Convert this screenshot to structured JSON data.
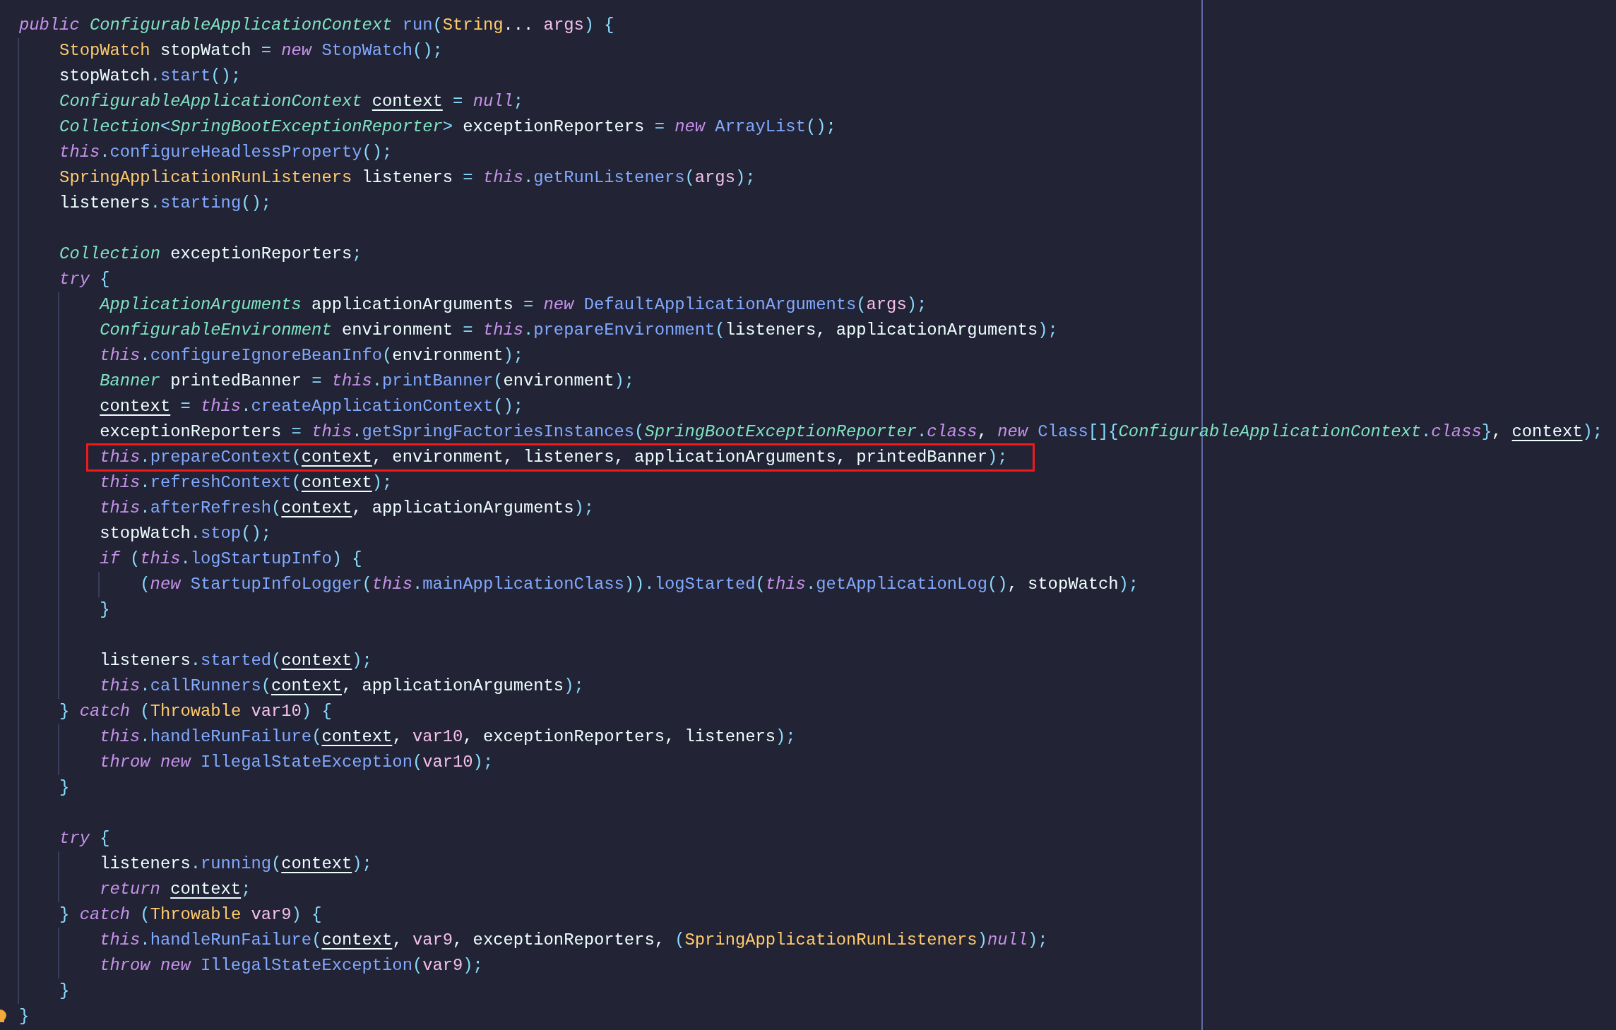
{
  "editor": {
    "lines": [
      {
        "highlighted": false,
        "tokens": [
          {
            "text": "public ",
            "kind": "keyword"
          },
          {
            "text": "ConfigurableApplicationContext ",
            "kind": "interface"
          },
          {
            "text": "run",
            "kind": "function"
          },
          {
            "text": "(",
            "kind": "punct"
          },
          {
            "text": "String",
            "kind": "type"
          },
          {
            "text": "... ",
            "kind": "plain"
          },
          {
            "text": "args",
            "kind": "param"
          },
          {
            "text": ") {",
            "kind": "punct"
          }
        ],
        "children": [
          {
            "highlighted": false,
            "tokens": [
              {
                "text": "StopWatch",
                "kind": "type"
              },
              {
                "text": " stopWatch ",
                "kind": "plain"
              },
              {
                "text": "= ",
                "kind": "punct"
              },
              {
                "text": "new ",
                "kind": "keyword"
              },
              {
                "text": "StopWatch",
                "kind": "function"
              },
              {
                "text": "();",
                "kind": "punct"
              }
            ]
          },
          {
            "highlighted": false,
            "tokens": [
              {
                "text": "stopWatch",
                "kind": "plain"
              },
              {
                "text": ".",
                "kind": "punct"
              },
              {
                "text": "start",
                "kind": "function"
              },
              {
                "text": "();",
                "kind": "punct"
              }
            ]
          },
          {
            "highlighted": false,
            "tokens": [
              {
                "text": "ConfigurableApplicationContext ",
                "kind": "interface"
              },
              {
                "text": "context",
                "kind": "field"
              },
              {
                "text": " = ",
                "kind": "punct"
              },
              {
                "text": "null",
                "kind": "keyword"
              },
              {
                "text": ";",
                "kind": "punct"
              }
            ]
          },
          {
            "highlighted": false,
            "tokens": [
              {
                "text": "Collection",
                "kind": "interface"
              },
              {
                "text": "<",
                "kind": "punct"
              },
              {
                "text": "SpringBootExceptionReporter",
                "kind": "interface"
              },
              {
                "text": ">",
                "kind": "punct"
              },
              {
                "text": " exceptionReporters ",
                "kind": "plain"
              },
              {
                "text": "= ",
                "kind": "punct"
              },
              {
                "text": "new ",
                "kind": "keyword"
              },
              {
                "text": "ArrayList",
                "kind": "function"
              },
              {
                "text": "();",
                "kind": "punct"
              }
            ]
          },
          {
            "highlighted": false,
            "tokens": [
              {
                "text": "this",
                "kind": "keyword"
              },
              {
                "text": ".",
                "kind": "punct"
              },
              {
                "text": "configureHeadlessProperty",
                "kind": "function"
              },
              {
                "text": "();",
                "kind": "punct"
              }
            ]
          },
          {
            "highlighted": false,
            "tokens": [
              {
                "text": "SpringApplicationRunListeners",
                "kind": "type"
              },
              {
                "text": " listeners ",
                "kind": "plain"
              },
              {
                "text": "= ",
                "kind": "punct"
              },
              {
                "text": "this",
                "kind": "keyword"
              },
              {
                "text": ".",
                "kind": "punct"
              },
              {
                "text": "getRunListeners",
                "kind": "function"
              },
              {
                "text": "(",
                "kind": "punct"
              },
              {
                "text": "args",
                "kind": "param"
              },
              {
                "text": ");",
                "kind": "punct"
              }
            ]
          },
          {
            "highlighted": false,
            "tokens": [
              {
                "text": "listeners",
                "kind": "plain"
              },
              {
                "text": ".",
                "kind": "punct"
              },
              {
                "text": "starting",
                "kind": "function"
              },
              {
                "text": "();",
                "kind": "punct"
              }
            ]
          },
          {
            "highlighted": false
          },
          {
            "highlighted": false,
            "tokens": [
              {
                "text": "Collection",
                "kind": "interface"
              },
              {
                "text": " exceptionReporters",
                "kind": "plain"
              },
              {
                "text": ";",
                "kind": "punct"
              }
            ]
          },
          {
            "highlighted": false,
            "tokens": [
              {
                "text": "try ",
                "kind": "keyword"
              },
              {
                "text": "{",
                "kind": "punct"
              }
            ],
            "children": [
              {
                "highlighted": false,
                "tokens": [
                  {
                    "text": "ApplicationArguments",
                    "kind": "interface"
                  },
                  {
                    "text": " applicationArguments ",
                    "kind": "plain"
                  },
                  {
                    "text": "= ",
                    "kind": "punct"
                  },
                  {
                    "text": "new ",
                    "kind": "keyword"
                  },
                  {
                    "text": "DefaultApplicationArguments",
                    "kind": "function"
                  },
                  {
                    "text": "(",
                    "kind": "punct"
                  },
                  {
                    "text": "args",
                    "kind": "param"
                  },
                  {
                    "text": ");",
                    "kind": "punct"
                  }
                ]
              },
              {
                "highlighted": false,
                "tokens": [
                  {
                    "text": "ConfigurableEnvironment",
                    "kind": "interface"
                  },
                  {
                    "text": " environment ",
                    "kind": "plain"
                  },
                  {
                    "text": "= ",
                    "kind": "punct"
                  },
                  {
                    "text": "this",
                    "kind": "keyword"
                  },
                  {
                    "text": ".",
                    "kind": "punct"
                  },
                  {
                    "text": "prepareEnvironment",
                    "kind": "function"
                  },
                  {
                    "text": "(",
                    "kind": "punct"
                  },
                  {
                    "text": "listeners, applicationArguments",
                    "kind": "plain"
                  },
                  {
                    "text": ");",
                    "kind": "punct"
                  }
                ]
              },
              {
                "highlighted": false,
                "tokens": [
                  {
                    "text": "this",
                    "kind": "keyword"
                  },
                  {
                    "text": ".",
                    "kind": "punct"
                  },
                  {
                    "text": "configureIgnoreBeanInfo",
                    "kind": "function"
                  },
                  {
                    "text": "(",
                    "kind": "punct"
                  },
                  {
                    "text": "environment",
                    "kind": "plain"
                  },
                  {
                    "text": ");",
                    "kind": "punct"
                  }
                ]
              },
              {
                "highlighted": false,
                "tokens": [
                  {
                    "text": "Banner",
                    "kind": "interface"
                  },
                  {
                    "text": " printedBanner ",
                    "kind": "plain"
                  },
                  {
                    "text": "= ",
                    "kind": "punct"
                  },
                  {
                    "text": "this",
                    "kind": "keyword"
                  },
                  {
                    "text": ".",
                    "kind": "punct"
                  },
                  {
                    "text": "printBanner",
                    "kind": "function"
                  },
                  {
                    "text": "(",
                    "kind": "punct"
                  },
                  {
                    "text": "environment",
                    "kind": "plain"
                  },
                  {
                    "text": ");",
                    "kind": "punct"
                  }
                ]
              },
              {
                "highlighted": false,
                "tokens": [
                  {
                    "text": "context",
                    "kind": "field"
                  },
                  {
                    "text": " = ",
                    "kind": "punct"
                  },
                  {
                    "text": "this",
                    "kind": "keyword"
                  },
                  {
                    "text": ".",
                    "kind": "punct"
                  },
                  {
                    "text": "createApplicationContext",
                    "kind": "function"
                  },
                  {
                    "text": "();",
                    "kind": "punct"
                  }
                ]
              },
              {
                "highlighted": false,
                "tokens": [
                  {
                    "text": "exceptionReporters ",
                    "kind": "plain"
                  },
                  {
                    "text": "= ",
                    "kind": "punct"
                  },
                  {
                    "text": "this",
                    "kind": "keyword"
                  },
                  {
                    "text": ".",
                    "kind": "punct"
                  },
                  {
                    "text": "getSpringFactoriesInstances",
                    "kind": "function"
                  },
                  {
                    "text": "(",
                    "kind": "punct"
                  },
                  {
                    "text": "SpringBootExceptionReporter",
                    "kind": "interface"
                  },
                  {
                    "text": ".",
                    "kind": "punct"
                  },
                  {
                    "text": "class",
                    "kind": "keyword"
                  },
                  {
                    "text": ", ",
                    "kind": "plain"
                  },
                  {
                    "text": "new ",
                    "kind": "keyword"
                  },
                  {
                    "text": "Class",
                    "kind": "function"
                  },
                  {
                    "text": "[]{",
                    "kind": "punct"
                  },
                  {
                    "text": "ConfigurableApplicationContext",
                    "kind": "interface"
                  },
                  {
                    "text": ".",
                    "kind": "punct"
                  },
                  {
                    "text": "class",
                    "kind": "keyword"
                  },
                  {
                    "text": "}",
                    "kind": "punct"
                  },
                  {
                    "text": ", ",
                    "kind": "plain"
                  },
                  {
                    "text": "context",
                    "kind": "field"
                  },
                  {
                    "text": ");",
                    "kind": "punct"
                  }
                ]
              },
              {
                "highlighted": true,
                "tokens": [
                  {
                    "text": "this",
                    "kind": "keyword"
                  },
                  {
                    "text": ".",
                    "kind": "punct"
                  },
                  {
                    "text": "prepareContext",
                    "kind": "function"
                  },
                  {
                    "text": "(",
                    "kind": "punct"
                  },
                  {
                    "text": "context",
                    "kind": "field"
                  },
                  {
                    "text": ", environment, listeners, applicationArguments, printedBanner",
                    "kind": "plain"
                  },
                  {
                    "text": ");",
                    "kind": "punct"
                  }
                ]
              },
              {
                "highlighted": false,
                "tokens": [
                  {
                    "text": "this",
                    "kind": "keyword"
                  },
                  {
                    "text": ".",
                    "kind": "punct"
                  },
                  {
                    "text": "refreshContext",
                    "kind": "function"
                  },
                  {
                    "text": "(",
                    "kind": "punct"
                  },
                  {
                    "text": "context",
                    "kind": "field"
                  },
                  {
                    "text": ");",
                    "kind": "punct"
                  }
                ]
              },
              {
                "highlighted": false,
                "tokens": [
                  {
                    "text": "this",
                    "kind": "keyword"
                  },
                  {
                    "text": ".",
                    "kind": "punct"
                  },
                  {
                    "text": "afterRefresh",
                    "kind": "function"
                  },
                  {
                    "text": "(",
                    "kind": "punct"
                  },
                  {
                    "text": "context",
                    "kind": "field"
                  },
                  {
                    "text": ", applicationArguments",
                    "kind": "plain"
                  },
                  {
                    "text": ");",
                    "kind": "punct"
                  }
                ]
              },
              {
                "highlighted": false,
                "tokens": [
                  {
                    "text": "stopWatch",
                    "kind": "plain"
                  },
                  {
                    "text": ".",
                    "kind": "punct"
                  },
                  {
                    "text": "stop",
                    "kind": "function"
                  },
                  {
                    "text": "();",
                    "kind": "punct"
                  }
                ]
              },
              {
                "highlighted": false,
                "tokens": [
                  {
                    "text": "if ",
                    "kind": "keyword"
                  },
                  {
                    "text": "(",
                    "kind": "punct"
                  },
                  {
                    "text": "this",
                    "kind": "keyword"
                  },
                  {
                    "text": ".",
                    "kind": "punct"
                  },
                  {
                    "text": "logStartupInfo",
                    "kind": "function"
                  },
                  {
                    "text": ") {",
                    "kind": "punct"
                  }
                ],
                "children": [
                  {
                    "highlighted": false,
                    "tokens": [
                      {
                        "text": "(",
                        "kind": "punct"
                      },
                      {
                        "text": "new ",
                        "kind": "keyword"
                      },
                      {
                        "text": "StartupInfoLogger",
                        "kind": "function"
                      },
                      {
                        "text": "(",
                        "kind": "punct"
                      },
                      {
                        "text": "this",
                        "kind": "keyword"
                      },
                      {
                        "text": ".",
                        "kind": "punct"
                      },
                      {
                        "text": "mainApplicationClass",
                        "kind": "function"
                      },
                      {
                        "text": ")).",
                        "kind": "punct"
                      },
                      {
                        "text": "logStarted",
                        "kind": "function"
                      },
                      {
                        "text": "(",
                        "kind": "punct"
                      },
                      {
                        "text": "this",
                        "kind": "keyword"
                      },
                      {
                        "text": ".",
                        "kind": "punct"
                      },
                      {
                        "text": "getApplicationLog",
                        "kind": "function"
                      },
                      {
                        "text": "()",
                        "kind": "punct"
                      },
                      {
                        "text": ", stopWatch",
                        "kind": "plain"
                      },
                      {
                        "text": ");",
                        "kind": "punct"
                      }
                    ]
                  }
                ]
              },
              {
                "highlighted": false,
                "tokens": [
                  {
                    "text": "}",
                    "kind": "punct"
                  }
                ]
              },
              {
                "highlighted": false
              },
              {
                "highlighted": false,
                "tokens": [
                  {
                    "text": "listeners",
                    "kind": "plain"
                  },
                  {
                    "text": ".",
                    "kind": "punct"
                  },
                  {
                    "text": "started",
                    "kind": "function"
                  },
                  {
                    "text": "(",
                    "kind": "punct"
                  },
                  {
                    "text": "context",
                    "kind": "field"
                  },
                  {
                    "text": ");",
                    "kind": "punct"
                  }
                ]
              },
              {
                "highlighted": false,
                "tokens": [
                  {
                    "text": "this",
                    "kind": "keyword"
                  },
                  {
                    "text": ".",
                    "kind": "punct"
                  },
                  {
                    "text": "callRunners",
                    "kind": "function"
                  },
                  {
                    "text": "(",
                    "kind": "punct"
                  },
                  {
                    "text": "context",
                    "kind": "field"
                  },
                  {
                    "text": ", applicationArguments",
                    "kind": "plain"
                  },
                  {
                    "text": ");",
                    "kind": "punct"
                  }
                ]
              }
            ]
          },
          {
            "highlighted": false,
            "tokens": [
              {
                "text": "} ",
                "kind": "punct"
              },
              {
                "text": "catch ",
                "kind": "keyword"
              },
              {
                "text": "(",
                "kind": "punct"
              },
              {
                "text": "Throwable ",
                "kind": "type"
              },
              {
                "text": "var10",
                "kind": "param"
              },
              {
                "text": ") {",
                "kind": "punct"
              }
            ],
            "children": [
              {
                "highlighted": false,
                "tokens": [
                  {
                    "text": "this",
                    "kind": "keyword"
                  },
                  {
                    "text": ".",
                    "kind": "punct"
                  },
                  {
                    "text": "handleRunFailure",
                    "kind": "function"
                  },
                  {
                    "text": "(",
                    "kind": "punct"
                  },
                  {
                    "text": "context",
                    "kind": "field"
                  },
                  {
                    "text": ", ",
                    "kind": "plain"
                  },
                  {
                    "text": "var10",
                    "kind": "param"
                  },
                  {
                    "text": ", exceptionReporters, listeners",
                    "kind": "plain"
                  },
                  {
                    "text": ");",
                    "kind": "punct"
                  }
                ]
              },
              {
                "highlighted": false,
                "tokens": [
                  {
                    "text": "throw new ",
                    "kind": "keyword"
                  },
                  {
                    "text": "IllegalStateException",
                    "kind": "function"
                  },
                  {
                    "text": "(",
                    "kind": "punct"
                  },
                  {
                    "text": "var10",
                    "kind": "param"
                  },
                  {
                    "text": ");",
                    "kind": "punct"
                  }
                ]
              }
            ]
          },
          {
            "highlighted": false,
            "tokens": [
              {
                "text": "}",
                "kind": "punct"
              }
            ]
          },
          {
            "highlighted": false
          },
          {
            "highlighted": false,
            "tokens": [
              {
                "text": "try ",
                "kind": "keyword"
              },
              {
                "text": "{",
                "kind": "punct"
              }
            ],
            "children": [
              {
                "highlighted": false,
                "tokens": [
                  {
                    "text": "listeners",
                    "kind": "plain"
                  },
                  {
                    "text": ".",
                    "kind": "punct"
                  },
                  {
                    "text": "running",
                    "kind": "function"
                  },
                  {
                    "text": "(",
                    "kind": "punct"
                  },
                  {
                    "text": "context",
                    "kind": "field"
                  },
                  {
                    "text": ");",
                    "kind": "punct"
                  }
                ]
              },
              {
                "highlighted": false,
                "tokens": [
                  {
                    "text": "return ",
                    "kind": "keyword"
                  },
                  {
                    "text": "context",
                    "kind": "field"
                  },
                  {
                    "text": ";",
                    "kind": "punct"
                  }
                ]
              }
            ]
          },
          {
            "highlighted": false,
            "tokens": [
              {
                "text": "} ",
                "kind": "punct"
              },
              {
                "text": "catch ",
                "kind": "keyword"
              },
              {
                "text": "(",
                "kind": "punct"
              },
              {
                "text": "Throwable ",
                "kind": "type"
              },
              {
                "text": "var9",
                "kind": "param"
              },
              {
                "text": ") {",
                "kind": "punct"
              }
            ],
            "children": [
              {
                "highlighted": false,
                "tokens": [
                  {
                    "text": "this",
                    "kind": "keyword"
                  },
                  {
                    "text": ".",
                    "kind": "punct"
                  },
                  {
                    "text": "handleRunFailure",
                    "kind": "function"
                  },
                  {
                    "text": "(",
                    "kind": "punct"
                  },
                  {
                    "text": "context",
                    "kind": "field"
                  },
                  {
                    "text": ", ",
                    "kind": "plain"
                  },
                  {
                    "text": "var9",
                    "kind": "param"
                  },
                  {
                    "text": ", exceptionReporters, ",
                    "kind": "plain"
                  },
                  {
                    "text": "(",
                    "kind": "punct"
                  },
                  {
                    "text": "SpringApplicationRunListeners",
                    "kind": "type"
                  },
                  {
                    "text": ")",
                    "kind": "punct"
                  },
                  {
                    "text": "null",
                    "kind": "keyword"
                  },
                  {
                    "text": ");",
                    "kind": "punct"
                  }
                ]
              },
              {
                "highlighted": false,
                "tokens": [
                  {
                    "text": "throw new ",
                    "kind": "keyword"
                  },
                  {
                    "text": "IllegalStateException",
                    "kind": "function"
                  },
                  {
                    "text": "(",
                    "kind": "punct"
                  },
                  {
                    "text": "var9",
                    "kind": "param"
                  },
                  {
                    "text": ");",
                    "kind": "punct"
                  }
                ]
              }
            ]
          },
          {
            "highlighted": false,
            "tokens": [
              {
                "text": "}",
                "kind": "punct"
              }
            ]
          }
        ]
      },
      {
        "highlighted": false,
        "tokens": [
          {
            "text": "}",
            "kind": "punct"
          }
        ]
      }
    ]
  }
}
